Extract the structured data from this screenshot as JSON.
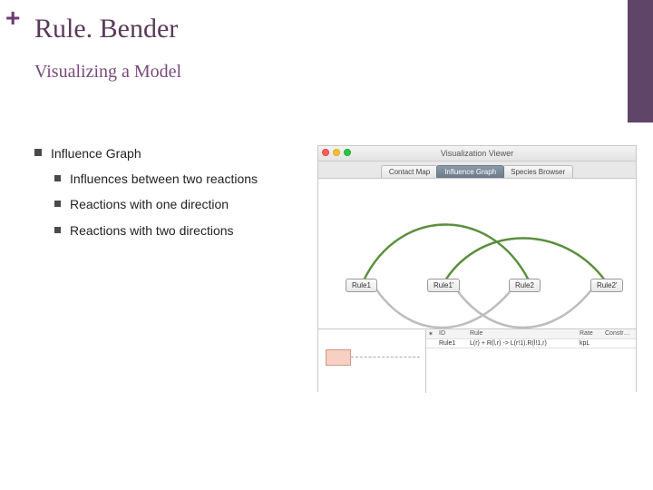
{
  "header": {
    "plus": "+",
    "title": "Rule. Bender",
    "subtitle": "Visualizing a Model"
  },
  "bullets": {
    "top": "Influence Graph",
    "sub1": "Influences between two reactions",
    "sub2": "Reactions with one direction",
    "sub3": "Reactions with two directions"
  },
  "viewer": {
    "window_title": "Visualization Viewer",
    "tabs": {
      "contact": "Contact Map",
      "influence": "Influence Graph",
      "species": "Species Browser"
    },
    "nodes": {
      "n1": "Rule1",
      "n2": "Rule1'",
      "n3": "Rule2",
      "n4": "Rule2'"
    },
    "table": {
      "headers": {
        "star": "✶",
        "id": "ID",
        "rule": "Rule",
        "rate": "Rate",
        "constr": "Constr…"
      },
      "row": {
        "id": "Rule1",
        "rule": "L(r) + R(l,r) -> L(r!1).R(l!1,r)",
        "rate": "kpL"
      }
    }
  }
}
